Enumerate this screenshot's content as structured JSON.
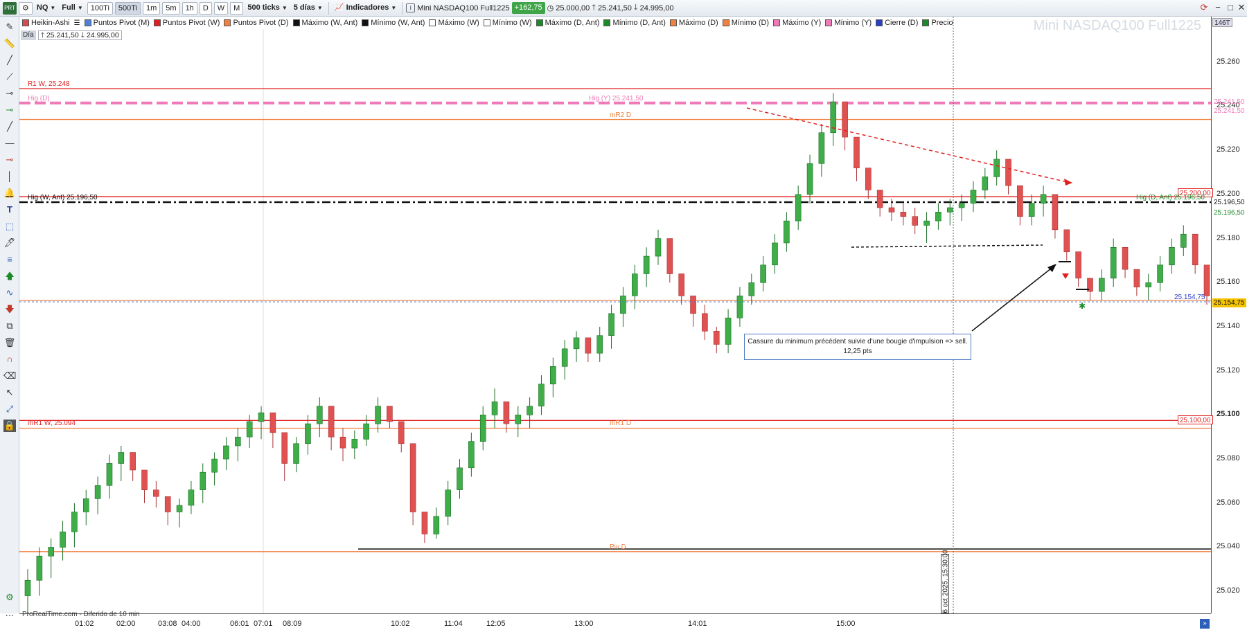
{
  "toolbar": {
    "logo_icon": "prorealtime-logo-icon",
    "instrument": "NQ",
    "mode": "Full",
    "buttons": [
      "100Ti",
      "500Ti",
      "1m",
      "5m",
      "1h",
      "D",
      "W",
      "M"
    ],
    "active_button": "500Ti",
    "ticks": "500 ticks",
    "range": "5 días",
    "indicators": "Indicadores",
    "instrument_name": "Mini NASDAQ100 Full1225",
    "change": "+162,75",
    "open_value": "25.000,00",
    "high_value": "25.241,50",
    "low_value": "24.995,00",
    "change_color": "#3fa548"
  },
  "legend": [
    {
      "label": "Heikin-Ashi",
      "color": "#d64b4b"
    },
    {
      "label": "Puntos Pivot (M)",
      "color": "#4f7fd6"
    },
    {
      "label": "Puntos Pivot (W)",
      "color": "#e02020"
    },
    {
      "label": "Puntos Pivot (D)",
      "color": "#f08040"
    },
    {
      "label": "Máximo (W, Ant)",
      "color": "#111111"
    },
    {
      "label": "Mínimo (W, Ant)",
      "color": "#111111"
    },
    {
      "label": "Máximo (W)",
      "color": "#ffffff"
    },
    {
      "label": "Mínimo (W)",
      "color": "#ffffff"
    },
    {
      "label": "Máximo (D, Ant)",
      "color": "#1d8a2a"
    },
    {
      "label": "Mínimo (D, Ant)",
      "color": "#1d8a2a"
    },
    {
      "label": "Máximo (D)",
      "color": "#f08040"
    },
    {
      "label": "Mínimo (D)",
      "color": "#f08040"
    },
    {
      "label": "Máximo (Y)",
      "color": "#f07ab9"
    },
    {
      "label": "Mínimo (Y)",
      "color": "#f07ab9"
    },
    {
      "label": "Cierre (D)",
      "color": "#2b3fc6"
    },
    {
      "label": "Precio",
      "color": "#1d8a2a"
    }
  ],
  "price_info": {
    "day": "Día",
    "high": "25.241,50",
    "low": "24.995,00"
  },
  "watermark": "Mini NASDAQ100 Full1225",
  "y_axis": {
    "top_badge": "146T",
    "ticks": [
      "25.260",
      "25.240",
      "25.220",
      "25.200",
      "25.180",
      "25.160",
      "25.140",
      "25.120",
      "25.100",
      "25.080",
      "25.060",
      "25.040",
      "25.020"
    ],
    "bold_tick": "25.100"
  },
  "x_axis": {
    "ticks": [
      "01:02",
      "02:00",
      "03:08",
      "04:00",
      "06:01",
      "07:01",
      "08:09",
      "10:02",
      "11:04",
      "12:05",
      "13:00",
      "14:01",
      "15:00"
    ]
  },
  "levels": [
    {
      "label": "R1 W, 25.248",
      "price": 25248,
      "color": "#e02020",
      "dash": "solid"
    },
    {
      "label": "Hig (D)",
      "price": 25241.5,
      "color": "#f07ab9",
      "dash": "dash"
    },
    {
      "label": "Hig (Y) 25.241,50",
      "price": 25241.5,
      "color": "#f07ab9",
      "dash": "none"
    },
    {
      "label": "mR2 D",
      "price": 25234,
      "color": "#f08040",
      "dash": "solid"
    },
    {
      "label": "Hig (W, Ant) 25.196,50",
      "price": 25196.5,
      "color": "#111111",
      "dash": "dashdot"
    },
    {
      "label": "Hig (D, Ant) 25.196,50",
      "price": 25196.5,
      "color": "#1d8a2a",
      "dash": "none"
    },
    {
      "label": "",
      "price": 25199,
      "color": "#e02020",
      "dash": "solid"
    },
    {
      "label": "",
      "price": 25152,
      "color": "#f08040",
      "dash": "solid"
    },
    {
      "label": "mR1 W, 25.094",
      "price": 25094,
      "color": "#e02020",
      "dash": "none"
    },
    {
      "label": "mR1 D",
      "price": 25094,
      "color": "#f08040",
      "dash": "solid"
    },
    {
      "label": "",
      "price": 25097.5,
      "color": "#e02020",
      "dash": "solid"
    },
    {
      "label": "Piv D",
      "price": 25038,
      "color": "#f08040",
      "dash": "solid"
    }
  ],
  "price_badges": {
    "b_25241_a": "25.241,50",
    "b_25241_b": "25.241,50",
    "b_25200": "25.200,00",
    "b_25196_a": "25.196,50",
    "b_25196_b": "25.196,50",
    "b_25154": "25.154,75",
    "b_25154_label": "25.154,75",
    "b_25100": "25.100,00"
  },
  "annotation": {
    "line1": "Cassure du minimum précédent suivie d'une bougie d'impulsion => sell.",
    "line2": "12,25 pts"
  },
  "footer": "ProRealTime.com - Diferido de 10 min",
  "date_marker": "6 oct 2025, 15:30:00",
  "chart_data": {
    "type": "candlestick",
    "title": "Mini NASDAQ100 Full1225",
    "ylim": [
      25010,
      25275
    ],
    "colors": {
      "up": "#3fae49",
      "down": "#e05252"
    },
    "series": [
      {
        "name": "Heikin-Ashi",
        "ohlc": [
          [
            25018,
            25030,
            25008,
            25025
          ],
          [
            25025,
            25040,
            25018,
            25036
          ],
          [
            25036,
            25044,
            25026,
            25040
          ],
          [
            25040,
            25052,
            25034,
            25047
          ],
          [
            25047,
            25060,
            25040,
            25056
          ],
          [
            25056,
            25066,
            25050,
            25062
          ],
          [
            25062,
            25072,
            25055,
            25068
          ],
          [
            25068,
            25082,
            25062,
            25078
          ],
          [
            25078,
            25086,
            25070,
            25083
          ],
          [
            25083,
            25078,
            25070,
            25075
          ],
          [
            25075,
            25072,
            25060,
            25066
          ],
          [
            25066,
            25070,
            25058,
            25063
          ],
          [
            25063,
            25060,
            25050,
            25056
          ],
          [
            25056,
            25062,
            25049,
            25059
          ],
          [
            25059,
            25070,
            25055,
            25066
          ],
          [
            25066,
            25078,
            25060,
            25074
          ],
          [
            25074,
            25083,
            25068,
            25080
          ],
          [
            25080,
            25090,
            25075,
            25086
          ],
          [
            25086,
            25094,
            25079,
            25090
          ],
          [
            25090,
            25100,
            25085,
            25097
          ],
          [
            25097,
            25104,
            25089,
            25101
          ],
          [
            25101,
            25099,
            25085,
            25092
          ],
          [
            25092,
            25088,
            25070,
            25078
          ],
          [
            25078,
            25090,
            25074,
            25087
          ],
          [
            25087,
            25100,
            25082,
            25096
          ],
          [
            25096,
            25108,
            25090,
            25104
          ],
          [
            25104,
            25098,
            25084,
            25090
          ],
          [
            25090,
            25094,
            25079,
            25085
          ],
          [
            25085,
            25093,
            25080,
            25089
          ],
          [
            25089,
            25100,
            25086,
            25096
          ],
          [
            25096,
            25108,
            25092,
            25104
          ],
          [
            25104,
            25100,
            25094,
            25097
          ],
          [
            25097,
            25096,
            25083,
            25087
          ],
          [
            25087,
            25072,
            25050,
            25056
          ],
          [
            25056,
            25050,
            25042,
            25046
          ],
          [
            25046,
            25058,
            25044,
            25054
          ],
          [
            25054,
            25070,
            25050,
            25066
          ],
          [
            25066,
            25080,
            25062,
            25076
          ],
          [
            25076,
            25092,
            25072,
            25088
          ],
          [
            25088,
            25104,
            25084,
            25100
          ],
          [
            25100,
            25112,
            25094,
            25106
          ],
          [
            25106,
            25100,
            25092,
            25096
          ],
          [
            25096,
            25104,
            25090,
            25100
          ],
          [
            25100,
            25108,
            25094,
            25104
          ],
          [
            25104,
            25118,
            25100,
            25114
          ],
          [
            25114,
            25126,
            25108,
            25122
          ],
          [
            25122,
            25134,
            25116,
            25130
          ],
          [
            25130,
            25138,
            25124,
            25135
          ],
          [
            25135,
            25130,
            25124,
            25128
          ],
          [
            25128,
            25140,
            25124,
            25136
          ],
          [
            25136,
            25150,
            25130,
            25146
          ],
          [
            25146,
            25158,
            25140,
            25154
          ],
          [
            25154,
            25168,
            25148,
            25164
          ],
          [
            25164,
            25176,
            25158,
            25172
          ],
          [
            25172,
            25184,
            25168,
            25180
          ],
          [
            25180,
            25174,
            25160,
            25164
          ],
          [
            25164,
            25158,
            25150,
            25154
          ],
          [
            25154,
            25152,
            25140,
            25146
          ],
          [
            25146,
            25150,
            25134,
            25138
          ],
          [
            25138,
            25140,
            25128,
            25132
          ],
          [
            25132,
            25148,
            25128,
            25144
          ],
          [
            25144,
            25158,
            25140,
            25154
          ],
          [
            25154,
            25164,
            25150,
            25160
          ],
          [
            25160,
            25172,
            25156,
            25168
          ],
          [
            25168,
            25182,
            25164,
            25178
          ],
          [
            25178,
            25192,
            25174,
            25188
          ],
          [
            25188,
            25204,
            25184,
            25200
          ],
          [
            25200,
            25218,
            25196,
            25214
          ],
          [
            25214,
            25232,
            25208,
            25228
          ],
          [
            25228,
            25246,
            25222,
            25242
          ],
          [
            25242,
            25236,
            25220,
            25226
          ],
          [
            25226,
            25222,
            25206,
            25212
          ],
          [
            25212,
            25208,
            25198,
            25202
          ],
          [
            25202,
            25198,
            25190,
            25194
          ],
          [
            25194,
            25198,
            25188,
            25192
          ],
          [
            25192,
            25196,
            25186,
            25190
          ],
          [
            25190,
            25194,
            25182,
            25186
          ],
          [
            25186,
            25192,
            25178,
            25188
          ],
          [
            25188,
            25196,
            25184,
            25192
          ],
          [
            25192,
            25198,
            25186,
            25194
          ],
          [
            25194,
            25200,
            25188,
            25196
          ],
          [
            25196,
            25206,
            25192,
            25202
          ],
          [
            25202,
            25212,
            25198,
            25208
          ],
          [
            25208,
            25220,
            25204,
            25216
          ],
          [
            25216,
            25214,
            25200,
            25204
          ],
          [
            25204,
            25198,
            25186,
            25190
          ],
          [
            25190,
            25200,
            25186,
            25196
          ],
          [
            25196,
            25204,
            25190,
            25200
          ],
          [
            25200,
            25196,
            25180,
            25184
          ],
          [
            25184,
            25176,
            25170,
            25174
          ],
          [
            25174,
            25168,
            25158,
            25162
          ],
          [
            25162,
            25160,
            25152,
            25156
          ],
          [
            25156,
            25166,
            25152,
            25162
          ],
          [
            25162,
            25180,
            25158,
            25176
          ],
          [
            25176,
            25172,
            25162,
            25166
          ],
          [
            25166,
            25164,
            25154,
            25158
          ],
          [
            25158,
            25164,
            25152,
            25160
          ],
          [
            25160,
            25172,
            25156,
            25168
          ],
          [
            25168,
            25180,
            25164,
            25176
          ],
          [
            25176,
            25186,
            25172,
            25182
          ],
          [
            25182,
            25174,
            25164,
            25168
          ],
          [
            25168,
            25160,
            25150,
            25154
          ]
        ]
      }
    ]
  }
}
